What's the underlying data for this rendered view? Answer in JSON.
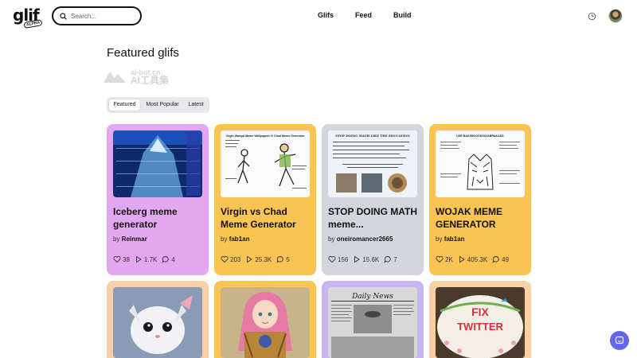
{
  "header": {
    "logo_text": "glif",
    "logo_badge": "ALPHA",
    "search_placeholder": "Search...",
    "nav": [
      "Glifs",
      "Feed",
      "Build"
    ]
  },
  "watermark": {
    "line1": "ai-bot.cn",
    "line2": "AI工具集"
  },
  "page_title": "Featured glifs",
  "tabs": [
    {
      "label": "Featured",
      "active": true
    },
    {
      "label": "Most Popular",
      "active": false
    },
    {
      "label": "Latest",
      "active": false
    }
  ],
  "cards": [
    {
      "title": "Iceberg meme generator",
      "author": "Reinmar",
      "likes": "38",
      "runs": "1.7K",
      "comments": "4",
      "color": "#e3a7f2"
    },
    {
      "title": "Virgin vs Chad Meme Generator",
      "author": "fab1an",
      "likes": "203",
      "runs": "25.3K",
      "comments": "5",
      "color": "#f9c452"
    },
    {
      "title": "STOP DOING MATH meme...",
      "author": "oneiromancer2665",
      "likes": "156",
      "runs": "15.6K",
      "comments": "7",
      "color": "#d3d6dd"
    },
    {
      "title": "WOJAK MEME GENERATOR",
      "author": "fab1an",
      "likes": "2K",
      "runs": "405.3K",
      "comments": "49",
      "color": "#f9c452"
    },
    {
      "title": "",
      "color": "#f9cfa6"
    },
    {
      "title": "",
      "color": "#f9c452"
    },
    {
      "title": "",
      "color": "#c9b5f2"
    },
    {
      "title": "",
      "color": "#f9cfa6"
    }
  ],
  "thumb_texts": {
    "virgin": "Virgin Wanyal Meme Wallpaperd IV Chad Meme Generator",
    "stop": "STOP DOING MATH LIKE THE EDUCATION",
    "wojak": "USE BADSNOOOKSAYABRAKADS",
    "news": "Daily News",
    "fix_line1": "FIX",
    "fix_line2": "TWITTER"
  },
  "by_prefix": "by"
}
